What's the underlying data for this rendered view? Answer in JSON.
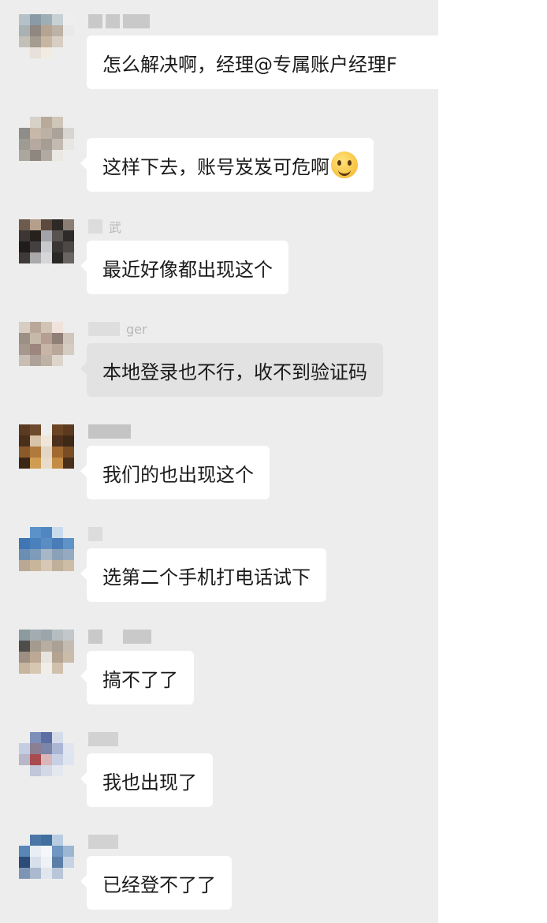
{
  "messages": [
    {
      "id": "m1",
      "text": "怎么解决啊，经理@专属账户经理F",
      "emoji": false,
      "highlight": false
    },
    {
      "id": "m2",
      "text": "这样下去，账号岌岌可危啊",
      "emoji": true,
      "highlight": false
    },
    {
      "id": "m3",
      "text": "最近好像都出现这个",
      "emoji": false,
      "highlight": false,
      "nick_visible": "武"
    },
    {
      "id": "m4",
      "text": "本地登录也不行，收不到验证码",
      "emoji": false,
      "highlight": true,
      "nick_visible": "ger"
    },
    {
      "id": "m5",
      "text": "我们的也出现这个",
      "emoji": false,
      "highlight": false
    },
    {
      "id": "m6",
      "text": "选第二个手机打电话试下",
      "emoji": false,
      "highlight": false
    },
    {
      "id": "m7",
      "text": "搞不了了",
      "emoji": false,
      "highlight": false
    },
    {
      "id": "m8",
      "text": "我也出现了",
      "emoji": false,
      "highlight": false
    },
    {
      "id": "m9",
      "text": "已经登不了了",
      "emoji": false,
      "highlight": false
    }
  ],
  "colors": {
    "chat_background": "#ededed",
    "bubble_background": "#ffffff",
    "bubble_highlight_background": "#e2e2e2",
    "text": "#1a1a1a"
  }
}
